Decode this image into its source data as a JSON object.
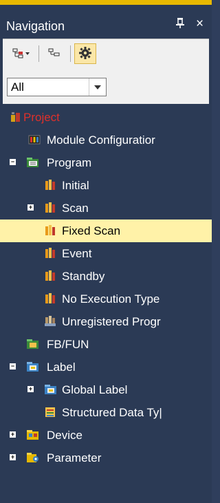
{
  "window": {
    "title": "Navigation",
    "pin_glyph": "ᅮ",
    "close_glyph": "×"
  },
  "toolbar": {
    "buttons": [
      {
        "name": "tree-view-icon",
        "glyph": "⊞▾"
      },
      {
        "name": "list-view-icon",
        "glyph": "⊟"
      },
      {
        "name": "settings-gear-icon",
        "glyph": "⚙"
      }
    ]
  },
  "filter": {
    "selected": "All"
  },
  "tree": {
    "project": "Project",
    "module_configuration": "Module Configuratior",
    "program": "Program",
    "initial": "Initial",
    "scan": "Scan",
    "fixed_scan": "Fixed Scan",
    "event": "Event",
    "standby": "Standby",
    "no_execution_type": "No Execution Type",
    "unregistered_program": "Unregistered Progr",
    "fb_fun": "FB/FUN",
    "label": "Label",
    "global_label": "Global Label",
    "structured_data_types": "Structured Data Ty|",
    "device": "Device",
    "parameter": "Parameter"
  },
  "colors": {
    "panel_bg": "#2b3a55",
    "selected_row": "#fff2a8",
    "project_text": "#e0302a",
    "active_tab_edge": "#e8b800"
  }
}
